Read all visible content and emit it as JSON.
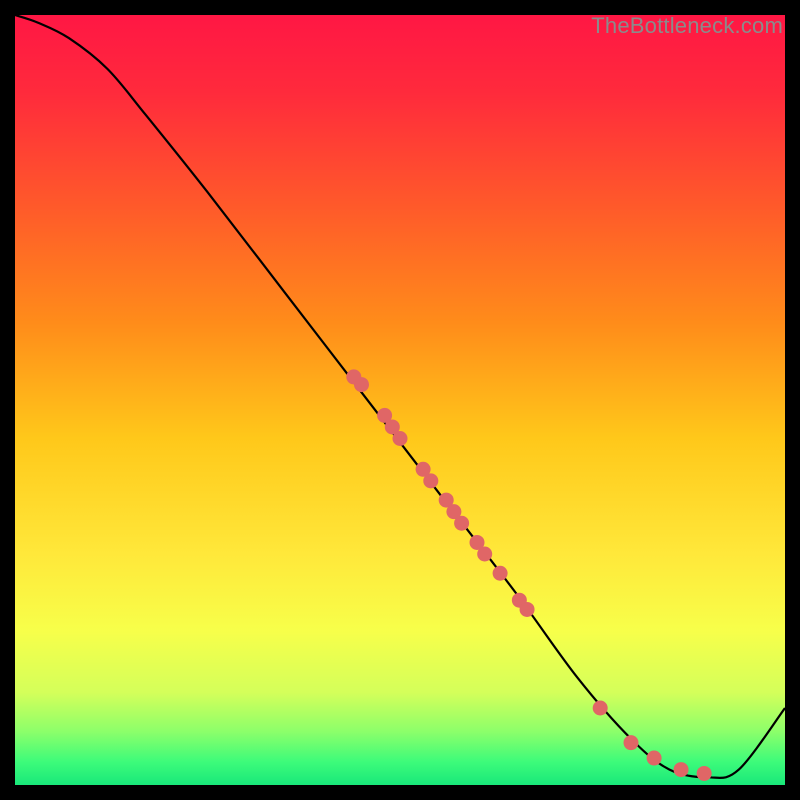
{
  "watermark": "TheBottleneck.com",
  "chart_data": {
    "type": "line",
    "title": "",
    "xlabel": "",
    "ylabel": "",
    "xlim": [
      0,
      100
    ],
    "ylim": [
      0,
      100
    ],
    "grid": false,
    "legend": false,
    "gradient_stops": [
      {
        "offset": 0.0,
        "color": "#ff1744"
      },
      {
        "offset": 0.1,
        "color": "#ff2a3c"
      },
      {
        "offset": 0.25,
        "color": "#ff5a2a"
      },
      {
        "offset": 0.4,
        "color": "#ff8c1a"
      },
      {
        "offset": 0.55,
        "color": "#ffc81a"
      },
      {
        "offset": 0.7,
        "color": "#ffe83a"
      },
      {
        "offset": 0.8,
        "color": "#f7ff4a"
      },
      {
        "offset": 0.88,
        "color": "#d4ff5a"
      },
      {
        "offset": 0.93,
        "color": "#8dff6a"
      },
      {
        "offset": 0.97,
        "color": "#3dfb7a"
      },
      {
        "offset": 1.0,
        "color": "#19e87a"
      }
    ],
    "curve": [
      {
        "x": 0,
        "y": 100
      },
      {
        "x": 3,
        "y": 99
      },
      {
        "x": 7,
        "y": 97
      },
      {
        "x": 12,
        "y": 93
      },
      {
        "x": 17,
        "y": 87
      },
      {
        "x": 25,
        "y": 77
      },
      {
        "x": 35,
        "y": 64
      },
      {
        "x": 45,
        "y": 51
      },
      {
        "x": 55,
        "y": 38
      },
      {
        "x": 65,
        "y": 25
      },
      {
        "x": 73,
        "y": 14
      },
      {
        "x": 80,
        "y": 6
      },
      {
        "x": 85,
        "y": 2
      },
      {
        "x": 90,
        "y": 1
      },
      {
        "x": 94,
        "y": 2
      },
      {
        "x": 100,
        "y": 10
      }
    ],
    "markers": [
      {
        "x": 44,
        "y": 53
      },
      {
        "x": 45,
        "y": 52
      },
      {
        "x": 48,
        "y": 48
      },
      {
        "x": 49,
        "y": 46.5
      },
      {
        "x": 50,
        "y": 45
      },
      {
        "x": 53,
        "y": 41
      },
      {
        "x": 54,
        "y": 39.5
      },
      {
        "x": 56,
        "y": 37
      },
      {
        "x": 57,
        "y": 35.5
      },
      {
        "x": 58,
        "y": 34
      },
      {
        "x": 60,
        "y": 31.5
      },
      {
        "x": 61,
        "y": 30
      },
      {
        "x": 63,
        "y": 27.5
      },
      {
        "x": 65.5,
        "y": 24
      },
      {
        "x": 66.5,
        "y": 22.8
      },
      {
        "x": 76,
        "y": 10
      },
      {
        "x": 80,
        "y": 5.5
      },
      {
        "x": 83,
        "y": 3.5
      },
      {
        "x": 86.5,
        "y": 2
      },
      {
        "x": 89.5,
        "y": 1.5
      }
    ],
    "marker_color": "#e06666",
    "curve_color": "#000000"
  }
}
